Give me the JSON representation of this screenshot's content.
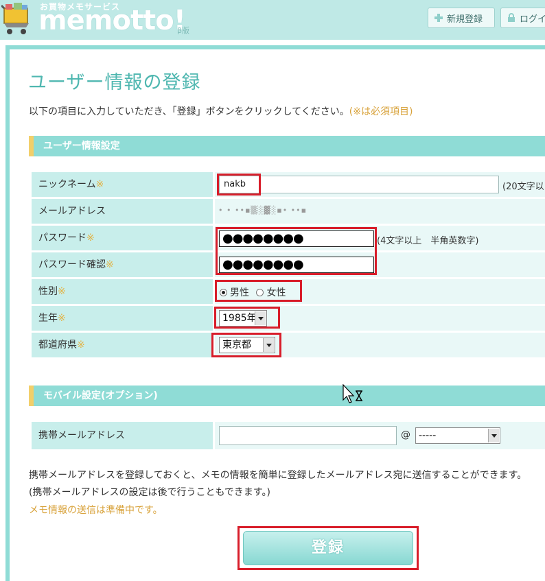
{
  "header": {
    "logo_sub": "お買物メモサービス",
    "logo_main": "memotto!",
    "logo_beta": "β版",
    "new_register": "新規登録",
    "login": "ログイ"
  },
  "page": {
    "title": "ユーザー情報の登録",
    "intro": "以下の項目に入力していただき、「登録」ボタンをクリックしてください。",
    "intro_required": "(※は必須項目)"
  },
  "section_user": {
    "title": "ユーザー情報設定",
    "nickname_label": "ニックネーム",
    "nickname_value": "nakb",
    "nickname_note": "(20文字以",
    "email_label": "メールアドレス",
    "email_value": "• • ••▪▒░▓░▪• ••▪",
    "password_label": "パスワード",
    "password_dots": "●●●●●●●●",
    "password_note": "(4文字以上　半角英数字)",
    "password_confirm_label": "パスワード確認",
    "password_confirm_dots": "●●●●●●●●",
    "gender_label": "性別",
    "gender_male": "男性",
    "gender_female": "女性",
    "birth_label": "生年",
    "birth_value": "1985年",
    "pref_label": "都道府県",
    "pref_value": "東京都",
    "required_mark": "※"
  },
  "section_mobile": {
    "title": "モバイル設定(オプション)",
    "mobile_label": "携帯メールアドレス",
    "at_mark": "@",
    "domain_value": "-----"
  },
  "info": {
    "line1": "携帯メールアドレスを登録しておくと、メモの情報を簡単に登録したメールアドレス宛に送信することができます。",
    "line2": "(携帯メールアドレスの設定は後で行うこともできます。)",
    "line3": "メモ情報の送信は準備中です。"
  },
  "submit_label": "登録",
  "colors": {
    "accent": "#8fdcd6",
    "header_bg": "#bfe9e6",
    "title": "#4fb7b0",
    "required": "#e2b347",
    "highlight": "#d81d2a"
  }
}
